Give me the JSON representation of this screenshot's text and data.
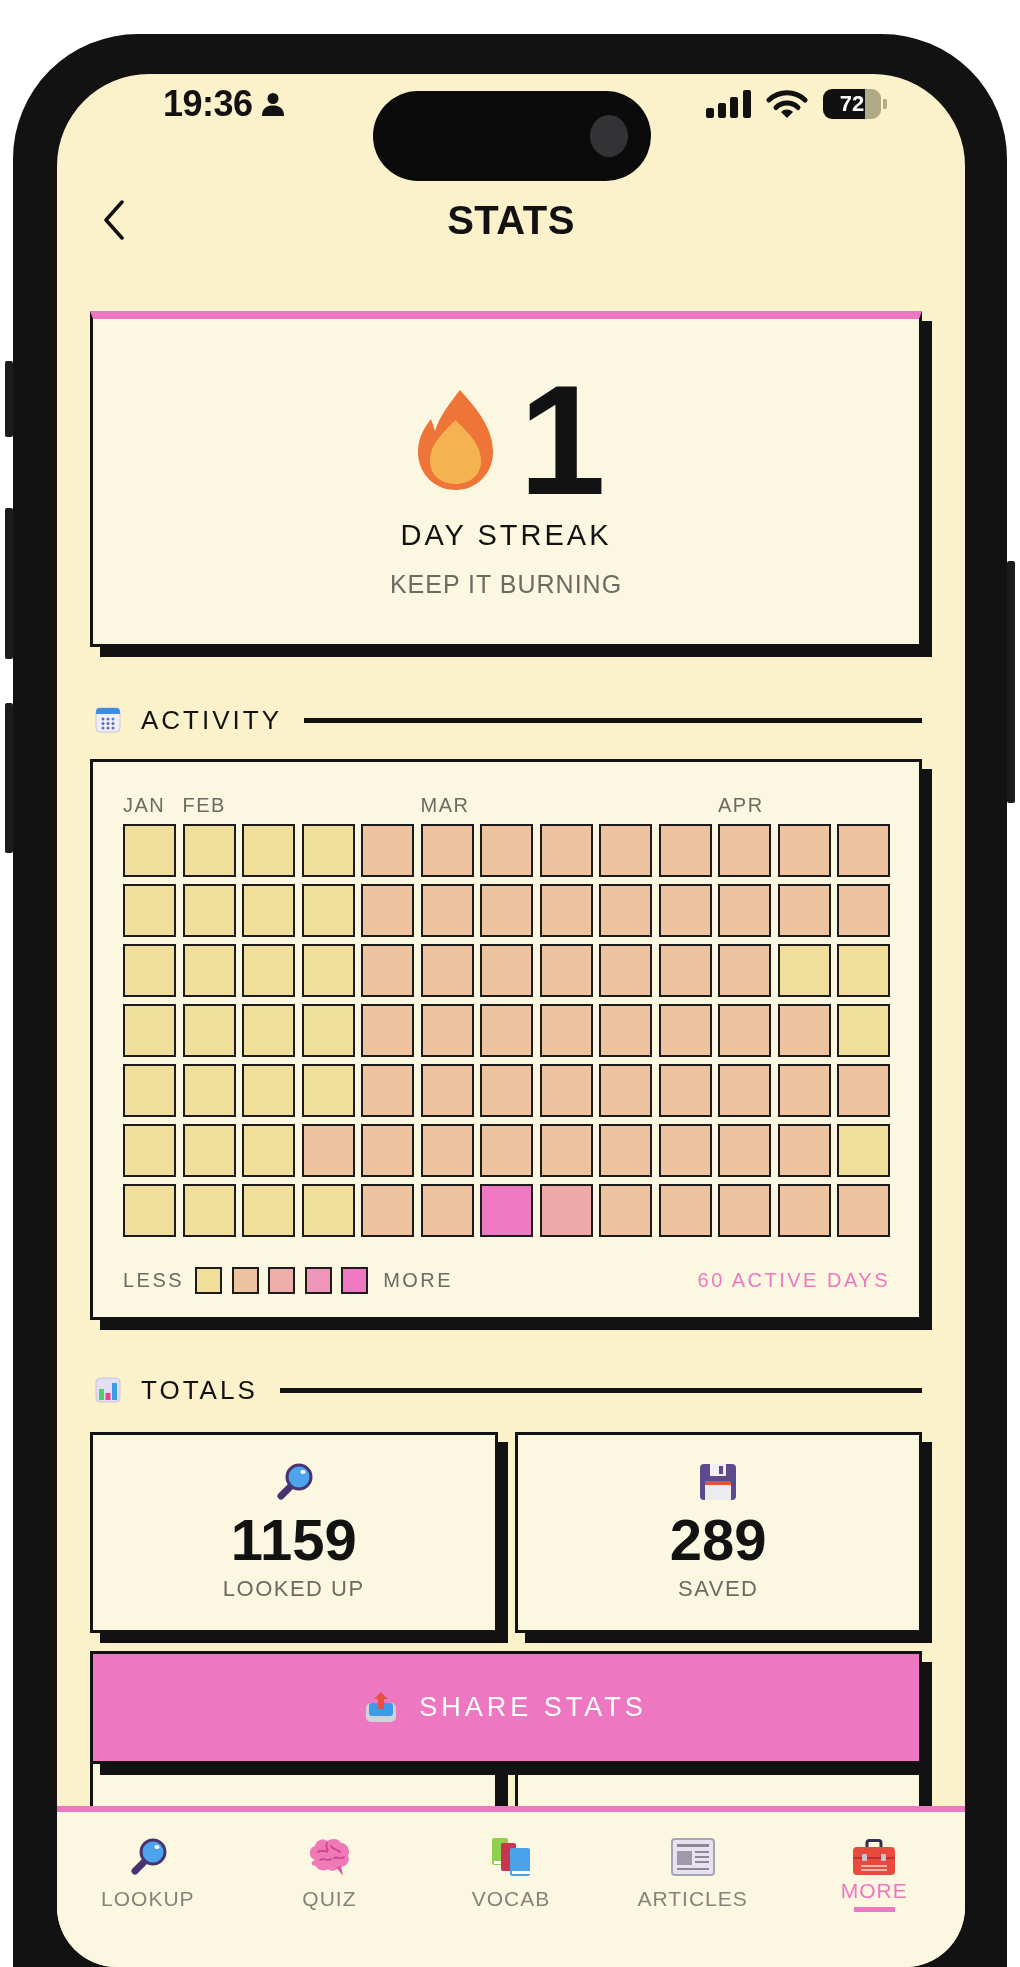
{
  "status_bar": {
    "time": "19:36",
    "battery": "72"
  },
  "header": {
    "title": "STATS"
  },
  "streak": {
    "count": "1",
    "label": "DAY STREAK",
    "subtitle": "KEEP IT BURNING"
  },
  "activity": {
    "title": "ACTIVITY",
    "weeks": [
      {
        "month": "JAN",
        "days": [
          {
            "color": "#f0df9a"
          },
          {
            "color": "#f0df9a"
          },
          {
            "color": "#f0df9a"
          },
          {
            "color": "#f0df9a"
          },
          {
            "color": "#f0df9a"
          },
          {
            "color": "#f0df9a"
          },
          {
            "color": "#f0df9a"
          }
        ]
      },
      {
        "month": "FEB",
        "days": [
          {
            "color": "#f0df9a"
          },
          {
            "color": "#f0df9a"
          },
          {
            "color": "#f0df9a"
          },
          {
            "color": "#f0df9a"
          },
          {
            "color": "#f0df9a"
          },
          {
            "color": "#f0df9a"
          },
          {
            "color": "#f0df9a"
          }
        ]
      },
      {
        "days": [
          {
            "color": "#f0df9a"
          },
          {
            "color": "#f0df9a"
          },
          {
            "color": "#f0df9a"
          },
          {
            "color": "#f0df9a"
          },
          {
            "color": "#f0df9a"
          },
          {
            "color": "#f0df9a"
          },
          {
            "color": "#f0df9a"
          }
        ]
      },
      {
        "days": [
          {
            "color": "#f0df9a"
          },
          {
            "color": "#f0df9a"
          },
          {
            "color": "#f0df9a"
          },
          {
            "color": "#f0df9a"
          },
          {
            "color": "#f0df9a"
          },
          {
            "color": "#eec4a0"
          },
          {
            "color": "#f0df9a"
          }
        ]
      },
      {
        "days": [
          {
            "color": "#eec4a0"
          },
          {
            "color": "#eec4a0"
          },
          {
            "color": "#eec4a0"
          },
          {
            "color": "#eec4a0"
          },
          {
            "color": "#eec4a0"
          },
          {
            "color": "#eec4a0"
          },
          {
            "color": "#eec4a0"
          }
        ]
      },
      {
        "month": "MAR",
        "days": [
          {
            "color": "#eec4a0"
          },
          {
            "color": "#eec4a0"
          },
          {
            "color": "#eec4a0"
          },
          {
            "color": "#eec4a0"
          },
          {
            "color": "#eec4a0"
          },
          {
            "color": "#eec4a0"
          },
          {
            "color": "#eec4a0"
          }
        ]
      },
      {
        "days": [
          {
            "color": "#eec4a0"
          },
          {
            "color": "#eec4a0"
          },
          {
            "color": "#eec4a0"
          },
          {
            "color": "#eec4a0"
          },
          {
            "color": "#eec4a0"
          },
          {
            "color": "#eec4a0"
          },
          {
            "color": "#ee78c2"
          }
        ]
      },
      {
        "days": [
          {
            "color": "#eec4a0"
          },
          {
            "color": "#eec4a0"
          },
          {
            "color": "#eec4a0"
          },
          {
            "color": "#eec4a0"
          },
          {
            "color": "#eec4a0"
          },
          {
            "color": "#eec4a0"
          },
          {
            "color": "#eeaaa8"
          }
        ]
      },
      {
        "days": [
          {
            "color": "#eec4a0"
          },
          {
            "color": "#eec4a0"
          },
          {
            "color": "#eec4a0"
          },
          {
            "color": "#eec4a0"
          },
          {
            "color": "#eec4a0"
          },
          {
            "color": "#eec4a0"
          },
          {
            "color": "#eec4a0"
          }
        ]
      },
      {
        "days": [
          {
            "color": "#eec4a0"
          },
          {
            "color": "#eec4a0"
          },
          {
            "color": "#eec4a0"
          },
          {
            "color": "#eec4a0"
          },
          {
            "color": "#eec4a0"
          },
          {
            "color": "#eec4a0"
          },
          {
            "color": "#eec4a0"
          }
        ]
      },
      {
        "month": "APR",
        "days": [
          {
            "color": "#eec4a0"
          },
          {
            "color": "#eec4a0"
          },
          {
            "color": "#eec4a0"
          },
          {
            "color": "#eec4a0"
          },
          {
            "color": "#eec4a0"
          },
          {
            "color": "#eec4a0"
          },
          {
            "color": "#eec4a0"
          }
        ]
      },
      {
        "days": [
          {
            "color": "#eec4a0"
          },
          {
            "color": "#eec4a0"
          },
          {
            "color": "#f0df9a"
          },
          {
            "color": "#eec4a0"
          },
          {
            "color": "#eec4a0"
          },
          {
            "color": "#eec4a0"
          },
          {
            "color": "#eec4a0"
          }
        ]
      },
      {
        "days": [
          {
            "color": "#eec4a0"
          },
          {
            "color": "#eec4a0"
          },
          {
            "color": "#f0df9a"
          },
          {
            "color": "#f0df9a"
          },
          {
            "color": "#eec4a0"
          },
          {
            "color": "#f0df9a"
          },
          {
            "color": "#eec4a0"
          }
        ]
      }
    ],
    "legend": {
      "less": "LESS",
      "more": "MORE",
      "swatches": [
        {
          "color": "#f0df9a"
        },
        {
          "color": "#eec4a0"
        },
        {
          "color": "#eeaea8"
        },
        {
          "color": "#ee95b9"
        },
        {
          "color": "#ee78c2"
        }
      ]
    },
    "summary": "60 ACTIVE DAYS"
  },
  "totals": {
    "title": "TOTALS",
    "cards": [
      {
        "kind": "magnifier",
        "value": "1159",
        "label": "LOOKED UP"
      },
      {
        "kind": "floppy",
        "value": "289",
        "label": "SAVED"
      }
    ]
  },
  "share_button": {
    "label": "SHARE STATS"
  },
  "tab_bar": {
    "tabs": [
      {
        "kind": "magnifier",
        "label": "LOOKUP",
        "selected": false
      },
      {
        "kind": "brain",
        "label": "QUIZ",
        "selected": false
      },
      {
        "kind": "books",
        "label": "VOCAB",
        "selected": false
      },
      {
        "kind": "newspaper",
        "label": "ARTICLES",
        "selected": false
      },
      {
        "kind": "toolbox",
        "label": "MORE",
        "selected": true
      }
    ]
  }
}
